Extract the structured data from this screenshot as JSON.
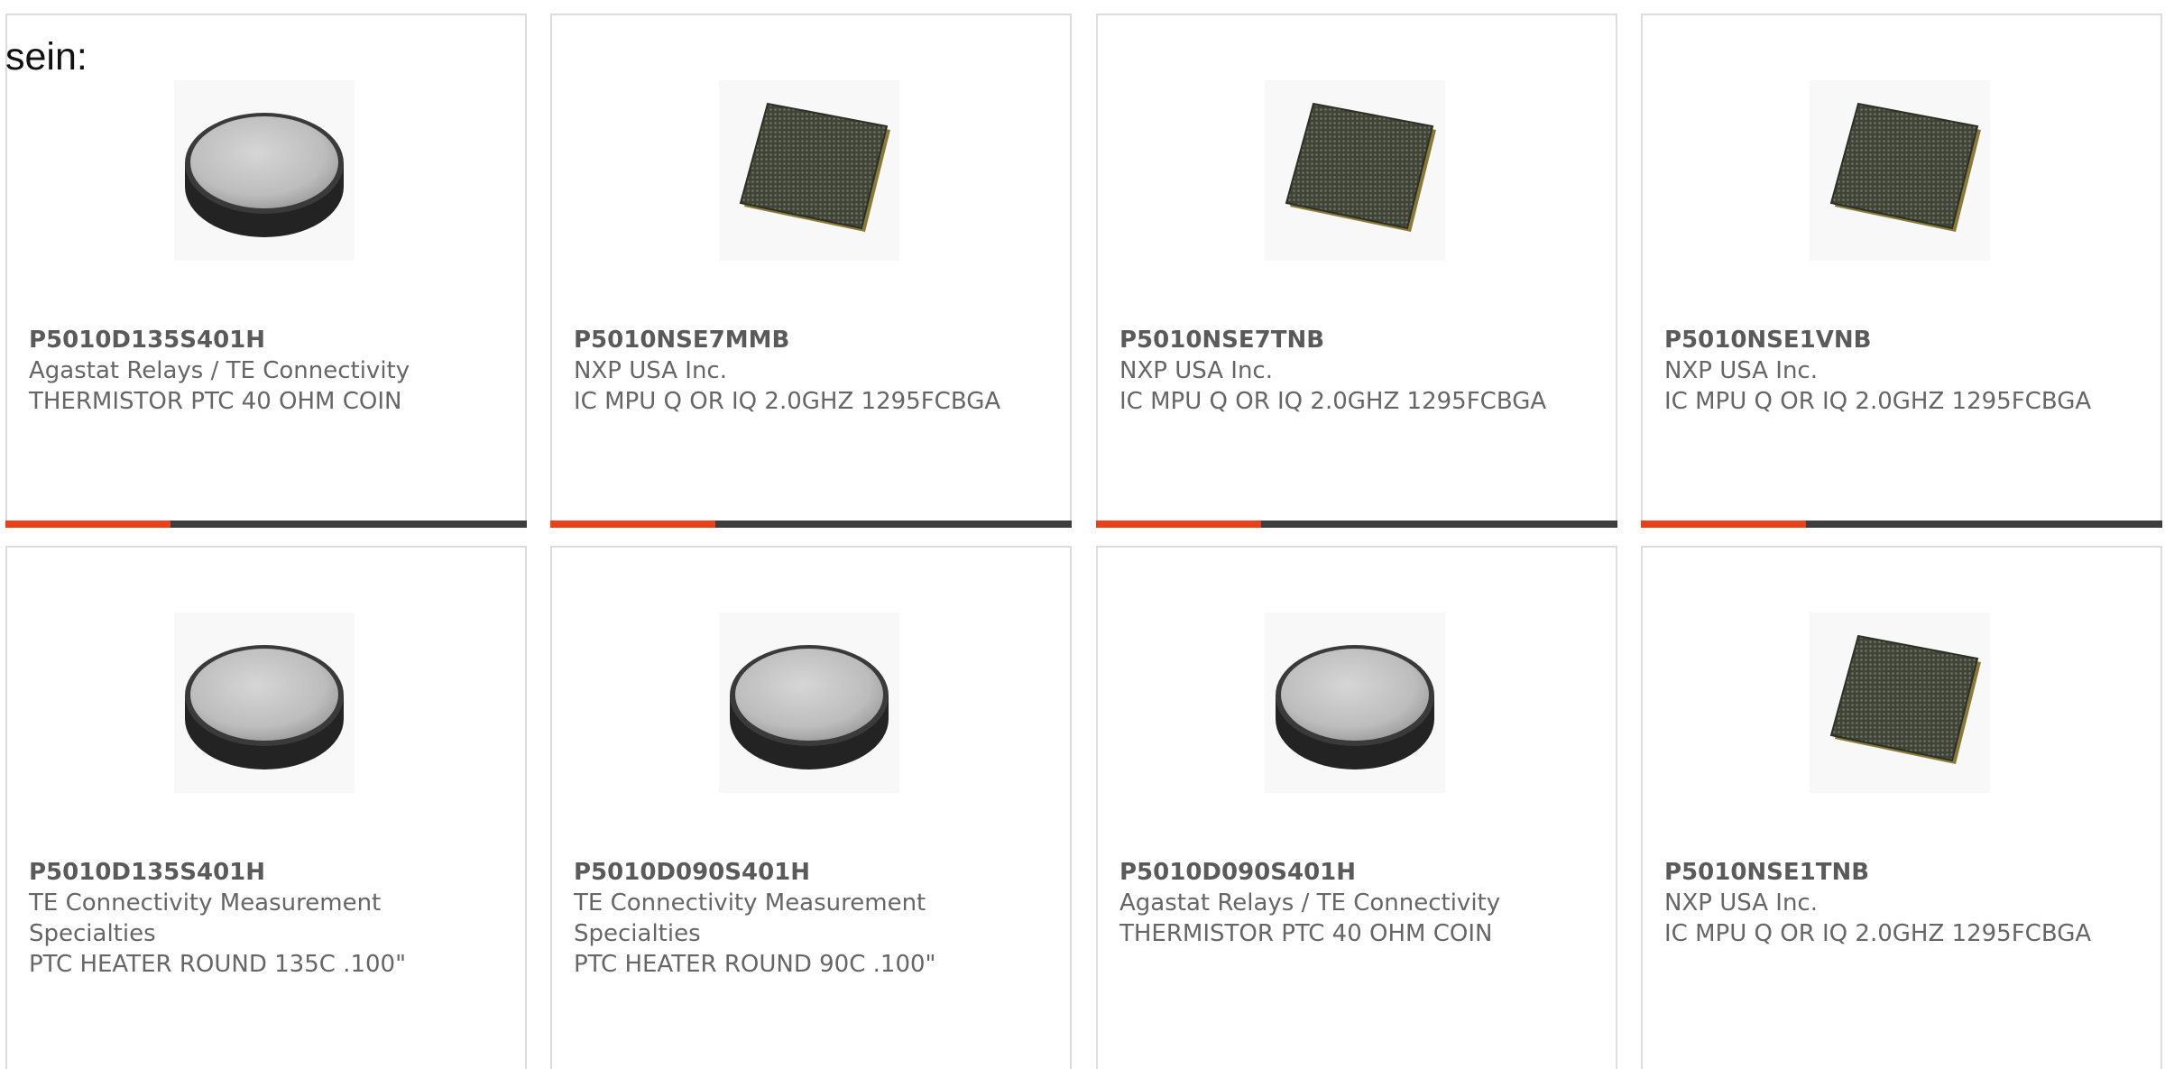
{
  "intro_text": "sein:",
  "colors": {
    "accent": "#e8411c",
    "bar_dark": "#3d3d3d",
    "text": "#666666",
    "border": "#dcdcdc"
  },
  "products": [
    {
      "part_number": "P5010D135S401H",
      "manufacturer": "Agastat Relays / TE Connectivity",
      "description": "THERMISTOR PTC 40 OHM COIN",
      "image_icon": "ptc-coin-thermistor-image"
    },
    {
      "part_number": "P5010NSE7MMB",
      "manufacturer": "NXP USA Inc.",
      "description": "IC MPU Q OR IQ 2.0GHZ 1295FCBGA",
      "image_icon": "bga-chip-image"
    },
    {
      "part_number": "P5010NSE7TNB",
      "manufacturer": "NXP USA Inc.",
      "description": "IC MPU Q OR IQ 2.0GHZ 1295FCBGA",
      "image_icon": "bga-chip-image"
    },
    {
      "part_number": "P5010NSE1VNB",
      "manufacturer": "NXP USA Inc.",
      "description": "IC MPU Q OR IQ 2.0GHZ 1295FCBGA",
      "image_icon": "bga-chip-image"
    },
    {
      "part_number": "P5010D135S401H",
      "manufacturer": "TE Connectivity Measurement Specialties",
      "description": "PTC HEATER ROUND 135C .100\"",
      "image_icon": "ptc-coin-thermistor-image"
    },
    {
      "part_number": "P5010D090S401H",
      "manufacturer": "TE Connectivity Measurement Specialties",
      "description": "PTC HEATER ROUND 90C .100\"",
      "image_icon": "ptc-coin-thermistor-image"
    },
    {
      "part_number": "P5010D090S401H",
      "manufacturer": "Agastat Relays / TE Connectivity",
      "description": "THERMISTOR PTC 40 OHM COIN",
      "image_icon": "ptc-coin-thermistor-image"
    },
    {
      "part_number": "P5010NSE1TNB",
      "manufacturer": "NXP USA Inc.",
      "description": "IC MPU Q OR IQ 2.0GHZ 1295FCBGA",
      "image_icon": "bga-chip-image"
    }
  ]
}
